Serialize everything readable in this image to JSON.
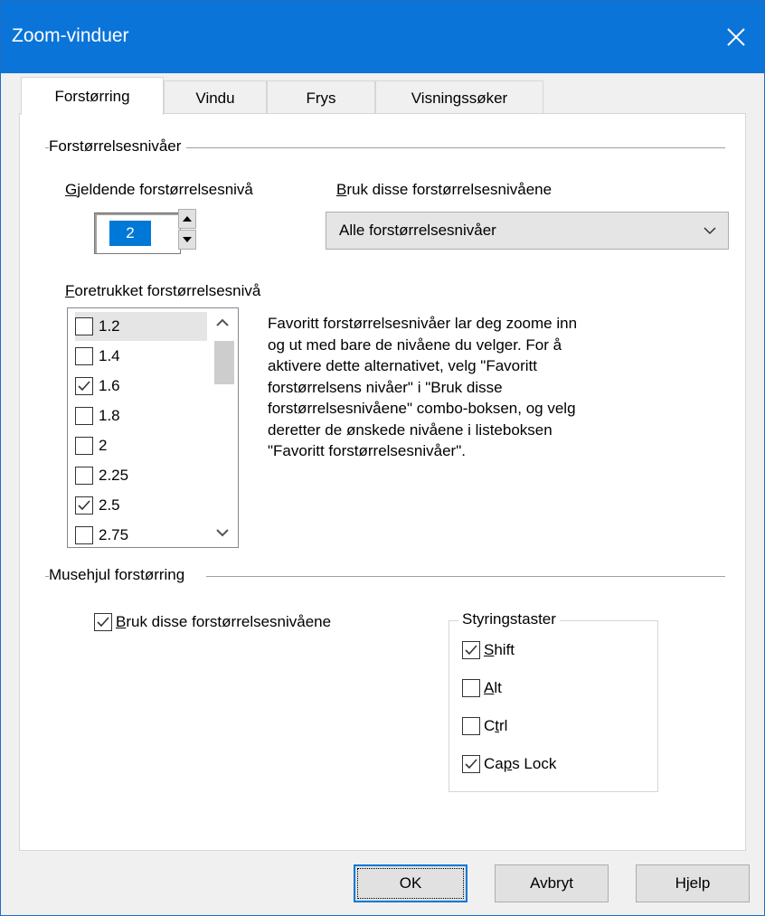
{
  "window": {
    "title": "Zoom-vinduer",
    "close_glyph": "✕"
  },
  "tabs": [
    {
      "label": "Forstørring",
      "active": true
    },
    {
      "label": "Vindu",
      "active": false
    },
    {
      "label": "Frys",
      "active": false
    },
    {
      "label": "Visningssøker",
      "active": false
    }
  ],
  "levels_group": {
    "title": "Forstørrelsesnivåer",
    "current_level_label": "Gjeldende forstørrelsesnivå",
    "current_level_value": "2",
    "use_levels_label": "Bruk disse forstørrelsesnivåene",
    "use_levels_selected": "Alle forstørrelsesnivåer",
    "preferred_label": "Foretrukket forstørrelsesnivå",
    "preferred_items": [
      {
        "label": "1.2",
        "checked": false,
        "selected": true
      },
      {
        "label": "1.4",
        "checked": false,
        "selected": false
      },
      {
        "label": "1.6",
        "checked": true,
        "selected": false
      },
      {
        "label": "1.8",
        "checked": false,
        "selected": false
      },
      {
        "label": "2",
        "checked": false,
        "selected": false
      },
      {
        "label": "2.25",
        "checked": false,
        "selected": false
      },
      {
        "label": "2.5",
        "checked": true,
        "selected": false
      },
      {
        "label": "2.75",
        "checked": false,
        "selected": false
      }
    ],
    "description_lines": [
      "Favoritt forstørrelsesnivåer lar deg zoome inn",
      "og ut med bare de nivåene du velger. For å",
      "aktivere dette alternativet, velg \"Favoritt",
      "forstørrelsens nivåer\" i \"Bruk disse",
      "forstørrelsesnivåene\" combo-boksen, og velg",
      "deretter de ønskede nivåene i listeboksen",
      "\"Favoritt forstørrelsesnivåer\"."
    ]
  },
  "wheel_group": {
    "title": "Musehjul forstørring",
    "use_levels_label": "Bruk disse forstørrelsesnivåene",
    "use_levels_checked": true,
    "modifier_keys": {
      "title": "Styringstaster",
      "items": [
        {
          "label": "Shift",
          "checked": true
        },
        {
          "label": "Alt",
          "checked": false
        },
        {
          "label": "Ctrl",
          "checked": false
        },
        {
          "label": "Caps Lock",
          "checked": true
        }
      ]
    }
  },
  "buttons": {
    "ok": "OK",
    "cancel": "Avbryt",
    "help": "Hjelp"
  },
  "colors": {
    "titlebar": "#0a74d8",
    "selection": "#0078d7"
  }
}
